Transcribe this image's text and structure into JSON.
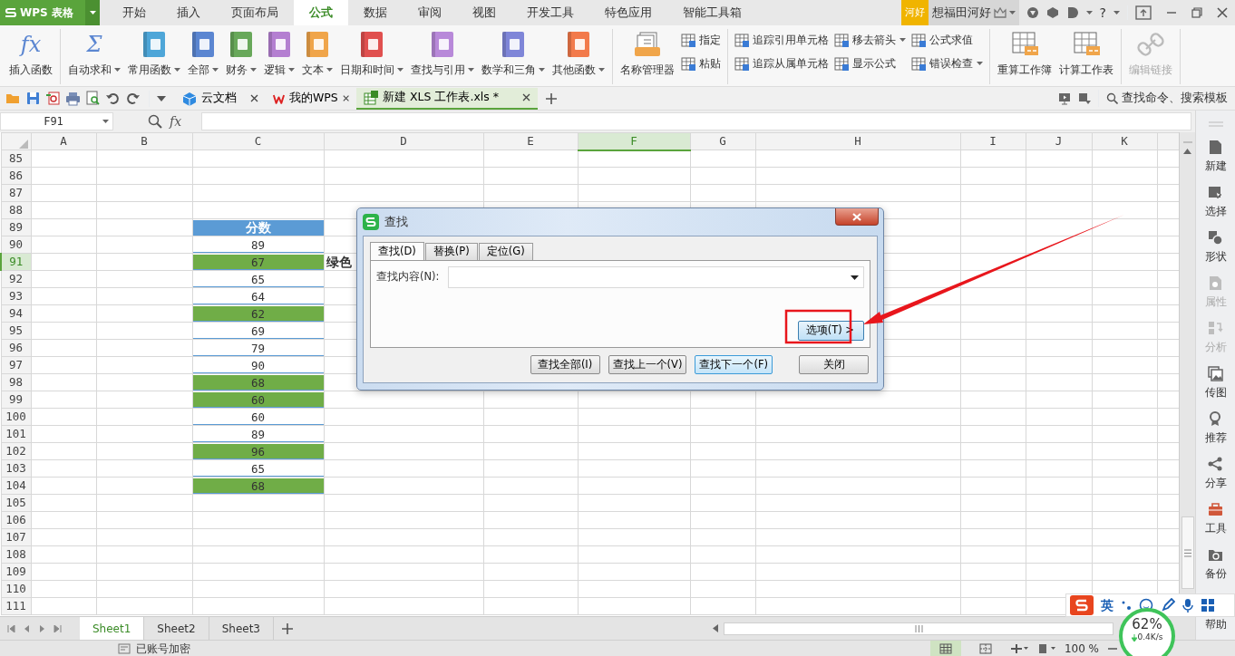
{
  "app_menu": {
    "label": "WPS 表格"
  },
  "menu_tabs": [
    {
      "label": "开始",
      "selected": false
    },
    {
      "label": "插入",
      "selected": false
    },
    {
      "label": "页面布局",
      "selected": false
    },
    {
      "label": "公式",
      "selected": true
    },
    {
      "label": "数据",
      "selected": false
    },
    {
      "label": "审阅",
      "selected": false
    },
    {
      "label": "视图",
      "selected": false
    },
    {
      "label": "开发工具",
      "selected": false
    },
    {
      "label": "特色应用",
      "selected": false
    },
    {
      "label": "智能工具箱",
      "selected": false
    }
  ],
  "account": {
    "badge": "河好",
    "user": "想福田河好",
    "help": "?"
  },
  "ribbon": {
    "groups": [
      {
        "items": [
          {
            "label": "插入函数",
            "kind": "glyph",
            "glyph": "fx",
            "dropdown": false,
            "disabled": false
          }
        ]
      },
      {
        "items": [
          {
            "label": "自动求和",
            "kind": "glyph",
            "glyph": "Σ",
            "dropdown": true,
            "disabled": false
          },
          {
            "label": "常用函数",
            "kind": "book",
            "color": "#4ea6d8",
            "dropdown": true,
            "disabled": false
          },
          {
            "label": "全部",
            "kind": "book",
            "color": "#5b86d1",
            "dropdown": true,
            "disabled": false
          },
          {
            "label": "财务",
            "kind": "book",
            "color": "#68a85a",
            "dropdown": true,
            "disabled": false
          },
          {
            "label": "逻辑",
            "kind": "book",
            "color": "#b47fd1",
            "dropdown": true,
            "disabled": false
          },
          {
            "label": "文本",
            "kind": "book",
            "color": "#f0a54a",
            "dropdown": true,
            "disabled": false
          },
          {
            "label": "日期和时间",
            "kind": "book",
            "color": "#e0504f",
            "dropdown": true,
            "disabled": false
          },
          {
            "label": "查找与引用",
            "kind": "book",
            "color": "#b889d9",
            "dropdown": true,
            "disabled": false
          },
          {
            "label": "数学和三角",
            "kind": "book",
            "color": "#7f86d8",
            "dropdown": true,
            "disabled": false
          },
          {
            "label": "其他函数",
            "kind": "book",
            "color": "#f27a4b",
            "dropdown": true,
            "disabled": false
          }
        ]
      },
      {
        "items": [
          {
            "label": "名称管理器",
            "kind": "tray",
            "dropdown": false,
            "disabled": false
          },
          {
            "label": "指定",
            "kind": "small",
            "dropdown": false,
            "disabled": false
          },
          {
            "label": "粘贴",
            "kind": "small",
            "dropdown": false,
            "disabled": false
          }
        ]
      },
      {
        "items": [
          {
            "label": "追踪引用单元格",
            "kind": "small",
            "dropdown": false,
            "disabled": false
          },
          {
            "label": "追踪从属单元格",
            "kind": "small",
            "dropdown": false,
            "disabled": false
          },
          {
            "label": "移去箭头",
            "kind": "small",
            "dropdown": true,
            "disabled": false
          },
          {
            "label": "显示公式",
            "kind": "small",
            "dropdown": false,
            "disabled": false
          },
          {
            "label": "公式求值",
            "kind": "small",
            "dropdown": false,
            "disabled": false
          },
          {
            "label": "错误检查",
            "kind": "small",
            "dropdown": true,
            "disabled": false
          }
        ]
      },
      {
        "items": [
          {
            "label": "重算工作簿",
            "kind": "sheet",
            "dropdown": false,
            "disabled": false
          },
          {
            "label": "计算工作表",
            "kind": "sheet",
            "dropdown": false,
            "disabled": false
          }
        ]
      },
      {
        "items": [
          {
            "label": "编辑链接",
            "kind": "link",
            "dropdown": false,
            "disabled": true
          }
        ]
      }
    ]
  },
  "doc_tabs": [
    {
      "label": "云文档",
      "kind": "cloud",
      "selected": false
    },
    {
      "label": "我的WPS",
      "kind": "wps",
      "selected": false
    },
    {
      "label": "新建 XLS 工作表.xls *",
      "kind": "sheet",
      "selected": true
    }
  ],
  "search": {
    "placeholder": "查找命令、搜索模板"
  },
  "formula_bar": {
    "name_box": "F91",
    "glyph": "fx"
  },
  "sheet": {
    "columns": [
      {
        "label": "A",
        "selected": false
      },
      {
        "label": "B",
        "selected": false
      },
      {
        "label": "C",
        "selected": false
      },
      {
        "label": "D",
        "selected": false
      },
      {
        "label": "E",
        "selected": false
      },
      {
        "label": "F",
        "selected": true
      },
      {
        "label": "G",
        "selected": false
      },
      {
        "label": "H",
        "selected": false
      },
      {
        "label": "I",
        "selected": false
      },
      {
        "label": "J",
        "selected": false
      },
      {
        "label": "K",
        "selected": false
      }
    ],
    "rows": [
      {
        "label": "85",
        "selected": false
      },
      {
        "label": "86",
        "selected": false
      },
      {
        "label": "87",
        "selected": false
      },
      {
        "label": "88",
        "selected": false
      },
      {
        "label": "89",
        "selected": false,
        "column_c": {
          "text": "分数",
          "color": "#5b9bd5",
          "kind": "header"
        }
      },
      {
        "label": "90",
        "selected": false,
        "column_c": {
          "text": "89",
          "color": "#ffffff"
        }
      },
      {
        "label": "91",
        "selected": true,
        "column_c": {
          "text": "67",
          "color": "#70ad47"
        },
        "column_d": {
          "text": "绿色",
          "bold": true
        }
      },
      {
        "label": "92",
        "selected": false,
        "column_c": {
          "text": "65",
          "color": "#ffffff"
        }
      },
      {
        "label": "93",
        "selected": false,
        "column_c": {
          "text": "64",
          "color": "#ffffff"
        }
      },
      {
        "label": "94",
        "selected": false,
        "column_c": {
          "text": "62",
          "color": "#70ad47"
        }
      },
      {
        "label": "95",
        "selected": false,
        "column_c": {
          "text": "69",
          "color": "#ffffff"
        }
      },
      {
        "label": "96",
        "selected": false,
        "column_c": {
          "text": "79",
          "color": "#ffffff"
        }
      },
      {
        "label": "97",
        "selected": false,
        "column_c": {
          "text": "90",
          "color": "#ffffff"
        }
      },
      {
        "label": "98",
        "selected": false,
        "column_c": {
          "text": "68",
          "color": "#70ad47"
        }
      },
      {
        "label": "99",
        "selected": false,
        "column_c": {
          "text": "60",
          "color": "#70ad47"
        }
      },
      {
        "label": "100",
        "selected": false,
        "column_c": {
          "text": "60",
          "color": "#ffffff"
        }
      },
      {
        "label": "101",
        "selected": false,
        "column_c": {
          "text": "89",
          "color": "#ffffff"
        }
      },
      {
        "label": "102",
        "selected": false,
        "column_c": {
          "text": "96",
          "color": "#70ad47"
        }
      },
      {
        "label": "103",
        "selected": false,
        "column_c": {
          "text": "65",
          "color": "#ffffff"
        }
      },
      {
        "label": "104",
        "selected": false,
        "column_c": {
          "text": "68",
          "color": "#70ad47"
        }
      },
      {
        "label": "105",
        "selected": false
      },
      {
        "label": "106",
        "selected": false
      },
      {
        "label": "107",
        "selected": false
      },
      {
        "label": "108",
        "selected": false
      },
      {
        "label": "109",
        "selected": false
      },
      {
        "label": "110",
        "selected": false
      },
      {
        "label": "111",
        "selected": false
      }
    ]
  },
  "sidebar": {
    "items": [
      {
        "label": "新建",
        "disabled": false
      },
      {
        "label": "选择",
        "disabled": false
      },
      {
        "label": "形状",
        "disabled": false
      },
      {
        "label": "属性",
        "disabled": true
      },
      {
        "label": "分析",
        "disabled": true
      },
      {
        "label": "传图",
        "disabled": false
      },
      {
        "label": "推荐",
        "disabled": false
      },
      {
        "label": "分享",
        "disabled": false
      },
      {
        "label": "工具",
        "disabled": false
      },
      {
        "label": "备份",
        "disabled": false
      }
    ],
    "help": "帮助"
  },
  "sheet_tabs": [
    {
      "label": "Sheet1",
      "selected": true
    },
    {
      "label": "Sheet2",
      "selected": false
    },
    {
      "label": "Sheet3",
      "selected": false
    }
  ],
  "status_bar": {
    "account": "已账号加密",
    "zoom": "100 %"
  },
  "ime_bar": {
    "mode": "英"
  },
  "network": {
    "percent": "62%",
    "speed": "0.4K/s"
  },
  "dialog": {
    "title": "查找",
    "tabs": [
      {
        "label": "查找(D)",
        "selected": true
      },
      {
        "label": "替换(P)",
        "selected": false
      },
      {
        "label": "定位(G)",
        "selected": false
      }
    ],
    "field": {
      "label": "查找内容(N):"
    },
    "options_button": "选项(T) >",
    "buttons": [
      {
        "label": "查找全部(I)",
        "default": false
      },
      {
        "label": "查找上一个(V)",
        "default": false
      },
      {
        "label": "查找下一个(F)",
        "default": true
      },
      {
        "label": "关闭",
        "default": false
      }
    ]
  }
}
